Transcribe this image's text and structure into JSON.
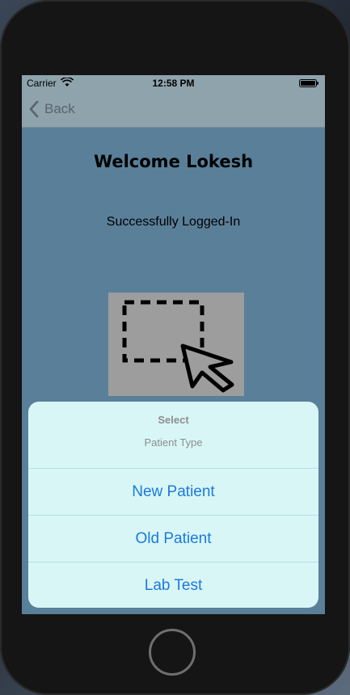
{
  "status_bar": {
    "carrier": "Carrier",
    "time": "12:58 PM"
  },
  "nav": {
    "back_label": "Back"
  },
  "main": {
    "welcome": "Welcome Lokesh",
    "status_message": "Successfully Logged-In",
    "image_icon": "select-area-cursor-icon"
  },
  "action_sheet": {
    "title": "Select",
    "message": "Patient Type",
    "actions": [
      {
        "label": "New Patient"
      },
      {
        "label": "Old Patient"
      },
      {
        "label": "Lab Test"
      }
    ]
  },
  "colors": {
    "background": "#5a7f99",
    "nav_bar": "#8fa3ad",
    "sheet_background": "#d9f6f6",
    "action_tint": "#1a7ae0"
  }
}
